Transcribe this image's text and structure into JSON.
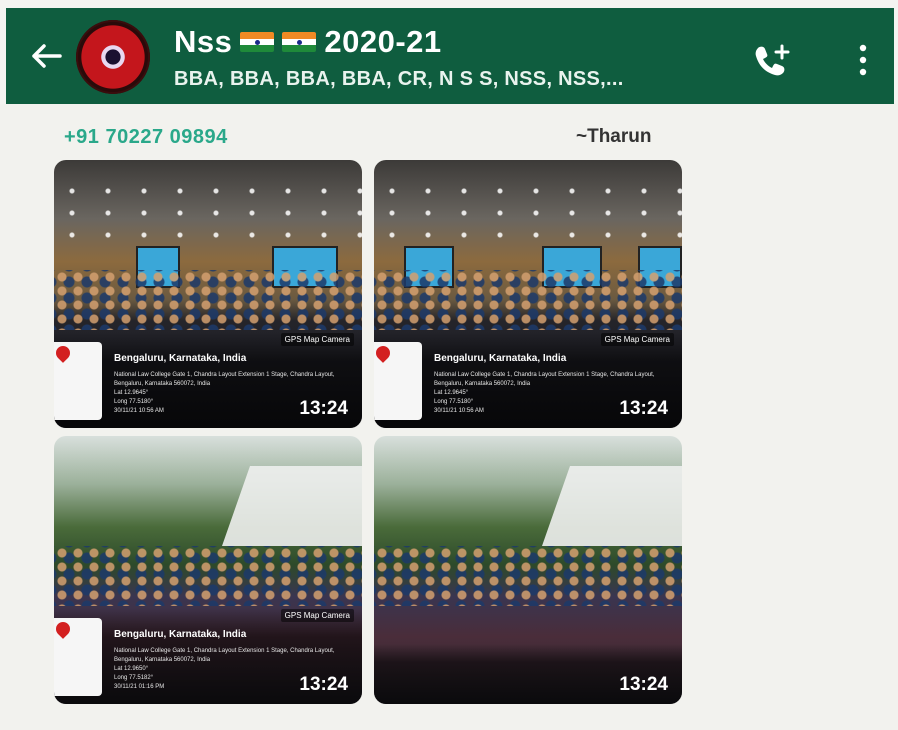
{
  "header": {
    "title": "Nss",
    "title_suffix": "2020-21",
    "subtitle": "BBA, BBA, BBA, BBA, CR, N S S, NSS, NSS,...",
    "colors": {
      "bar": "#0f5d3f",
      "text": "#ffffff"
    },
    "icons": [
      "back-arrow-icon",
      "group-avatar",
      "india-flag-icon",
      "india-flag-icon",
      "add-call-icon",
      "more-options-icon"
    ]
  },
  "message": {
    "sender_phone": "+91 70227 09894",
    "sender_name": "~Tharun",
    "photos": [
      {
        "kind": "indoor",
        "location": "Bengaluru, Karnataka, India",
        "address": "National Law College Gate 1, Chandra Layout Extension 1 Stage, Chandra Layout, Bengaluru, Karnataka 560072, India\nLat 12.9645°\nLong 77.5180°\n30/11/21 10:56 AM",
        "badge": "GPS Map Camera",
        "time": "13:24"
      },
      {
        "kind": "indoor",
        "location": "Bengaluru, Karnataka, India",
        "address": "National Law College Gate 1, Chandra Layout Extension 1 Stage, Chandra Layout, Bengaluru, Karnataka 560072, India\nLat 12.9645°\nLong 77.5180°\n30/11/21 10:56 AM",
        "badge": "GPS Map Camera",
        "time": "13:24"
      },
      {
        "kind": "outdoor",
        "location": "Bengaluru, Karnataka, India",
        "address": "National Law College Gate 1, Chandra Layout Extension 1 Stage, Chandra Layout, Bengaluru, Karnataka 560072, India\nLat 12.9650°\nLong 77.5182°\n30/11/21 01:16 PM",
        "badge": "GPS Map Camera",
        "time": "13:24"
      },
      {
        "kind": "outdoor",
        "location": "",
        "address": "",
        "badge": "",
        "time": "13:24"
      }
    ]
  }
}
